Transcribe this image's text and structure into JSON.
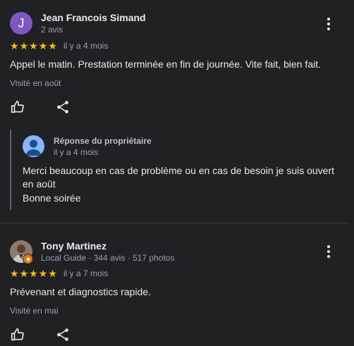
{
  "review1": {
    "avatar_letter": "J",
    "name": "Jean Francois Simand",
    "meta": "2 avis",
    "rating": 5,
    "time": "il y a 4 mois",
    "text": "Appel le matin. Prestation terminée en fin de journée. Vite fait, bien fait.",
    "visited": "Visité en août"
  },
  "owner_reply": {
    "title": "Réponse du propriétaire",
    "time": "il y a 4 mois",
    "line1": "Merci beaucoup en cas de problème ou en cas de besoin je suis ouvert",
    "line2": "en août",
    "line3": "Bonne soirée"
  },
  "review2": {
    "name": "Tony Martinez",
    "meta": "Local Guide · 344 avis · 517 photos",
    "rating": 5,
    "time": "il y a 7 mois",
    "text": "Prévenant et diagnostics rapide.",
    "visited": "Visité en mai"
  },
  "colors": {
    "star": "#fbbc04",
    "background": "#202124",
    "avatar_j": "#7e57c2",
    "local_guide_badge": "#e37400"
  },
  "icons": [
    "more-vert-icon",
    "thumb-up-icon",
    "share-icon",
    "person-icon"
  ]
}
